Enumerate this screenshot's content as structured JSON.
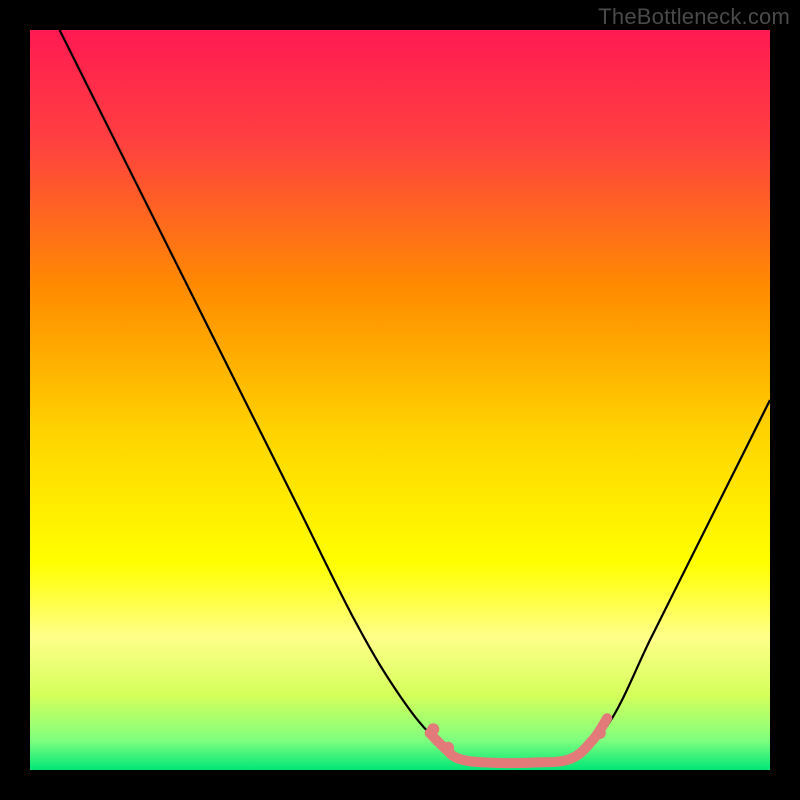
{
  "watermark": "TheBottleneck.com",
  "chart_data": {
    "type": "line",
    "title": "",
    "xlabel": "",
    "ylabel": "",
    "xlim": [
      0,
      100
    ],
    "ylim": [
      0,
      100
    ],
    "grid": false,
    "legend": false,
    "background_gradient": {
      "stops": [
        {
          "offset": 0.0,
          "color": "#ff1a52"
        },
        {
          "offset": 0.15,
          "color": "#ff4040"
        },
        {
          "offset": 0.35,
          "color": "#ff8c00"
        },
        {
          "offset": 0.55,
          "color": "#ffd500"
        },
        {
          "offset": 0.72,
          "color": "#ffff00"
        },
        {
          "offset": 0.82,
          "color": "#ffff8a"
        },
        {
          "offset": 0.9,
          "color": "#d4ff5a"
        },
        {
          "offset": 0.96,
          "color": "#7fff7f"
        },
        {
          "offset": 1.0,
          "color": "#00e676"
        }
      ]
    },
    "series": [
      {
        "name": "bottleneck-curve",
        "color": "#000000",
        "width": 2.2,
        "points": [
          {
            "x": 4,
            "y": 100
          },
          {
            "x": 8,
            "y": 92
          },
          {
            "x": 14,
            "y": 80
          },
          {
            "x": 20,
            "y": 68
          },
          {
            "x": 28,
            "y": 52
          },
          {
            "x": 36,
            "y": 36
          },
          {
            "x": 44,
            "y": 20
          },
          {
            "x": 50,
            "y": 10
          },
          {
            "x": 55,
            "y": 4
          },
          {
            "x": 60,
            "y": 1
          },
          {
            "x": 66,
            "y": 1
          },
          {
            "x": 72,
            "y": 1
          },
          {
            "x": 78,
            "y": 6
          },
          {
            "x": 84,
            "y": 18
          },
          {
            "x": 90,
            "y": 30
          },
          {
            "x": 96,
            "y": 42
          },
          {
            "x": 100,
            "y": 50
          }
        ]
      },
      {
        "name": "optimal-band",
        "color": "#e27a7a",
        "width": 10,
        "linecap": "round",
        "points": [
          {
            "x": 54,
            "y": 5
          },
          {
            "x": 56,
            "y": 3
          },
          {
            "x": 58,
            "y": 1.5
          },
          {
            "x": 62,
            "y": 1
          },
          {
            "x": 68,
            "y": 1
          },
          {
            "x": 73,
            "y": 1.5
          },
          {
            "x": 76,
            "y": 4
          },
          {
            "x": 78,
            "y": 7
          }
        ]
      }
    ],
    "markers": [
      {
        "x": 54.5,
        "y": 5.5,
        "r": 6,
        "color": "#e27a7a"
      },
      {
        "x": 56.5,
        "y": 3.0,
        "r": 6,
        "color": "#e27a7a"
      },
      {
        "x": 77.0,
        "y": 5.0,
        "r": 6,
        "color": "#e27a7a"
      }
    ]
  }
}
